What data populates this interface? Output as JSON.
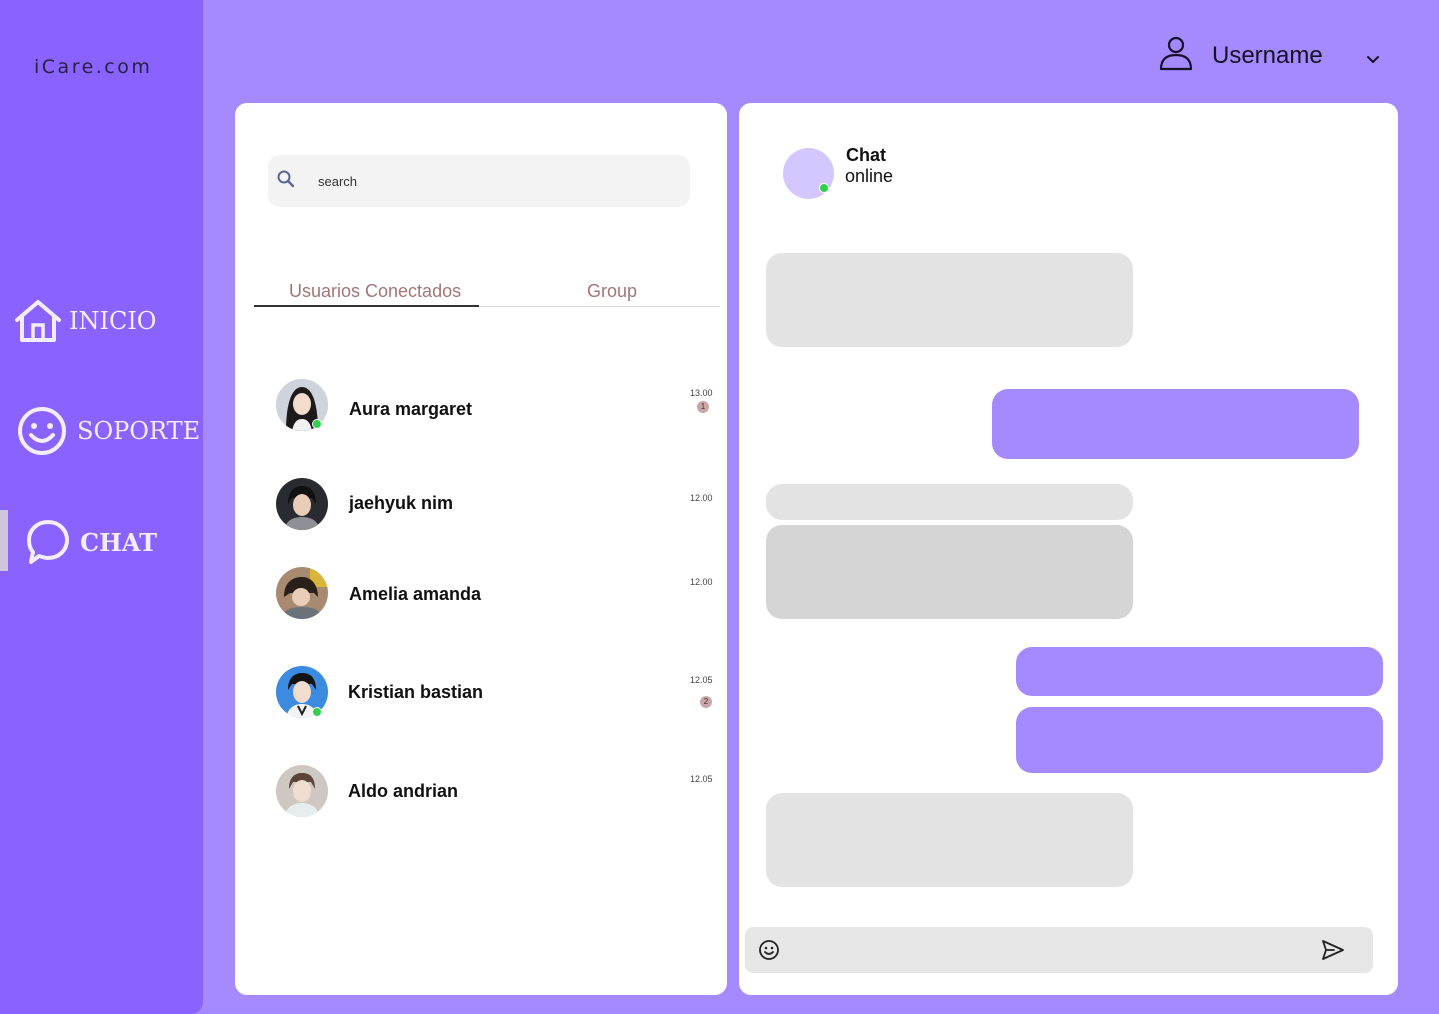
{
  "app": {
    "logo": "iCare.com"
  },
  "sidebar": {
    "items": [
      {
        "label": "INICIO",
        "icon": "home-icon"
      },
      {
        "label": "SOPORTE",
        "icon": "smiley-icon"
      },
      {
        "label": "CHAT",
        "icon": "chat-bubble-icon",
        "active": true
      }
    ]
  },
  "header": {
    "username": "Username",
    "user_icon": "user-icon",
    "menu_icon": "chevron-down-icon"
  },
  "contacts_panel": {
    "search": {
      "placeholder": "search",
      "icon": "search-icon"
    },
    "tabs": [
      {
        "label": "Usuarios Conectados",
        "active": true
      },
      {
        "label": "Group",
        "active": false
      }
    ],
    "contacts": [
      {
        "name": "Aura margaret",
        "time": "13.00",
        "unread": "1",
        "online": true
      },
      {
        "name": "jaehyuk nim",
        "time": "12.00",
        "unread": null,
        "online": false
      },
      {
        "name": "Amelia amanda",
        "time": "12.00",
        "unread": null,
        "online": false
      },
      {
        "name": "Kristian bastian",
        "time": "12.05",
        "unread": "2",
        "online": true
      },
      {
        "name": "Aldo andrian",
        "time": "12.05",
        "unread": null,
        "online": false
      }
    ]
  },
  "chat_panel": {
    "title": "Chat",
    "status": "online",
    "composer": {
      "placeholder": "",
      "emoji_icon": "emoji-icon",
      "send_icon": "send-icon"
    }
  },
  "colors": {
    "background": "#a589ff",
    "sidebar": "#8a63ff",
    "sent_bubble": "#a589ff",
    "received_bubble": "#e3e3e3",
    "online": "#2fd14a",
    "tab_text": "#a47476",
    "badge": "#c9a7a9"
  }
}
